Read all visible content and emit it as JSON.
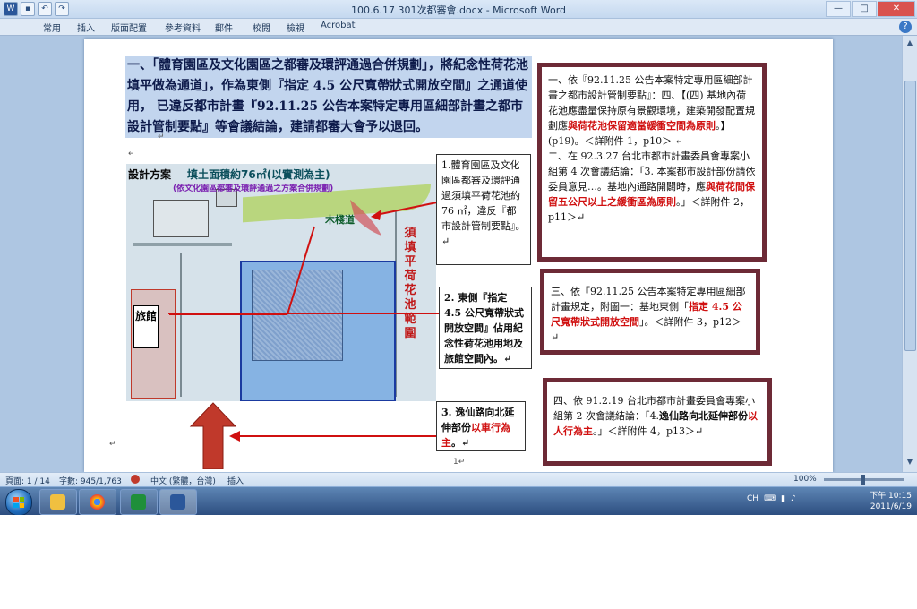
{
  "window": {
    "title": "100.6.17 301次都審會.docx - Microsoft Word",
    "controls": {
      "minimize": "—",
      "maximize": "□",
      "close": "✕"
    }
  },
  "quick_access": {
    "save_icon": "save-icon",
    "undo": "↶",
    "redo": "↷"
  },
  "ribbon": {
    "tabs": [
      "常用",
      "插入",
      "版面配置",
      "參考資料",
      "郵件",
      "校閱",
      "檢視",
      "Acrobat"
    ],
    "help": "?"
  },
  "document": {
    "heading": "一、「體育園區及文化園區之都審及環評通過合併規劃」，將紀念性荷花池填平做為通道」，作為東側『指定 4.5 公尺寬帶狀式開放空間』之通道使用， 已違反都市計畫『92.11.25 公告本案特定專用區細部計畫之都市設計管制要點』等會議結論，建請都審大會予以退回。",
    "para_mark": "↵",
    "figure": {
      "title": "設計方案",
      "area": "填土面積約76㎡(以實測為主)",
      "subtitle": "(依文化園區都審及環評通過之方案合併規劃)",
      "mulabel": "木棧道",
      "vertical_label": "須填平荷花池範圍",
      "inn": "旅館"
    },
    "callouts": [
      {
        "text": "1.體育園區及文化園區都審及環評通過須填平荷花池約 76 ㎡，違反『都市設計管制要點』。↵"
      },
      {
        "text": "2. 東側『指定 4.5 公尺寬帶狀式開放空間』佔用紀念性荷花池用地及旅館空間內。↵"
      },
      {
        "prefix": "3. 逸仙路向北延伸部份",
        "red": "以車行為主",
        "suffix": "。↵"
      }
    ],
    "notes": [
      {
        "p1": {
          "pre": "一、依『92.11.25 公告本案特定專用區細部計畫之都市設計管制要點』：四、【(四) 基地內荷花池應盡量保持原有景觀環境，建築開發配置規劃應",
          "red": "與荷花池保留適當緩衝空間為原則",
          "post": "。】(p19)。＜詳附件 1，p10＞ ↵"
        },
        "p2": {
          "pre": "二、在 92.3.27 台北市都市計畫委員會專案小組第 4 次會議結論：「3. 本案都市設計部份請依委員意見…。基地內通路開闢時，應",
          "red": "與荷花間保留五公尺以上之緩衝區為原則",
          "post": "。」＜詳附件 2，p11＞↵"
        }
      },
      {
        "pre": "三、依『92.11.25 公告本案特定專用區細部計畫規定，附圖一：基地東側「",
        "red": "指定 4.5 公尺寬帶狀式開放空間",
        "post": "」。＜詳附件 3，p12＞↵"
      },
      {
        "pre": "四、依 91.2.19 台北市都市計畫委員會專案小組第 2 次會議結論：「4.",
        "bold": "逸仙路向北延伸部份",
        "red": "以人行為主",
        "post": "。」＜詳附件 4，p13＞↵"
      }
    ],
    "page_number": "1↵"
  },
  "statusbar": {
    "page": "頁面: 1 / 14",
    "words": "字數: 945/1,763",
    "language": "中文 (繁體，台灣)",
    "mode": "插入",
    "zoom": "100%",
    "zoom_fraction": 0.5
  },
  "taskbar": {
    "lang": "CH",
    "time": "下午 10:15",
    "date": "2011/6/19",
    "apps": [
      "explorer-icon",
      "chrome-icon",
      "app-icon",
      "word-icon"
    ]
  },
  "colors": {
    "accent_red": "#d01010",
    "note_border": "#6d2a36",
    "zone_blue": "#1a3aa0"
  }
}
